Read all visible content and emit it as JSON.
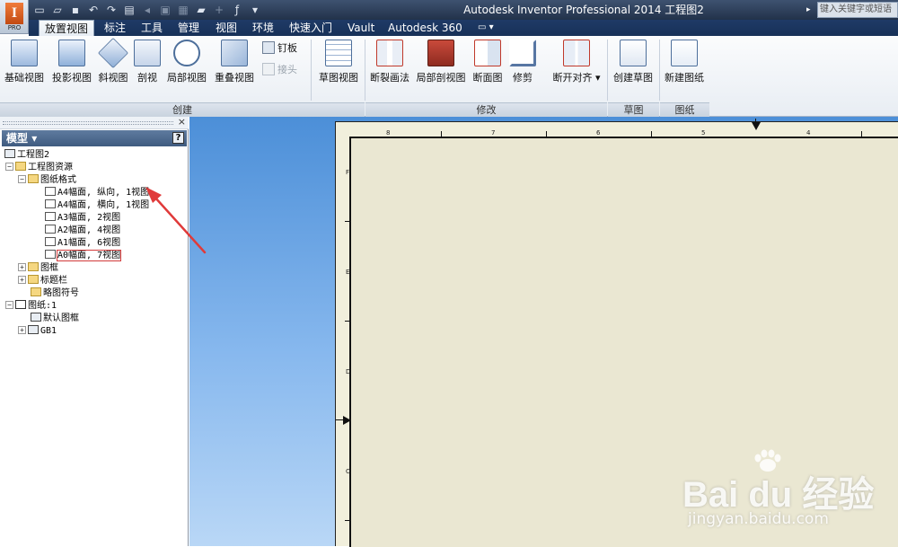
{
  "app": {
    "logo_letter": "I",
    "logo_sub": "PRO"
  },
  "title": "Autodesk Inventor Professional 2014    工程图2",
  "help_search": {
    "placeholder": "键入关键字或短语"
  },
  "qat": [
    "new-icon",
    "open-icon",
    "save-icon",
    "undo-icon",
    "redo-icon",
    "print-icon",
    "home-icon",
    "select-icon",
    "update-icon",
    "return-icon",
    "fx-icon",
    "customize-icon"
  ],
  "tabs": [
    "放置视图",
    "标注",
    "工具",
    "管理",
    "视图",
    "环境",
    "快速入门",
    "Vault",
    "Autodesk 360"
  ],
  "ribbon": {
    "create": {
      "label": "创建",
      "buttons": [
        "基础视图",
        "投影视图",
        "斜视图",
        "剖视",
        "局部视图",
        "重叠视图"
      ],
      "small": [
        "钉板",
        "接头"
      ]
    },
    "sketch_view": "草图视图",
    "modify": {
      "label": "修改",
      "buttons": [
        "断裂画法",
        "局部剖视图",
        "断面图",
        "修剪",
        "断开对齐"
      ]
    },
    "sketch": {
      "label": "草图",
      "buttons": [
        "创建草图"
      ]
    },
    "sheet": {
      "label": "图纸",
      "buttons": [
        "新建图纸"
      ]
    }
  },
  "browser": {
    "title": "模型",
    "help": "?",
    "close": "×",
    "tree": [
      {
        "label": "工程图2"
      },
      {
        "label": "工程图资源"
      },
      {
        "label": "图纸格式"
      },
      {
        "label": "A4幅面, 纵向, 1视图"
      },
      {
        "label": "A4幅面, 横向, 1视图"
      },
      {
        "label": "A3幅面, 2视图"
      },
      {
        "label": "A2幅面, 4视图"
      },
      {
        "label": "A1幅面, 6视图"
      },
      {
        "label": "A0幅面, 7视图"
      },
      {
        "label": "图框"
      },
      {
        "label": "标题栏"
      },
      {
        "label": "略图符号"
      },
      {
        "label": "图纸:1"
      },
      {
        "label": "默认图框"
      },
      {
        "label": "GB1"
      }
    ]
  },
  "drawing": {
    "col_zones": [
      "8",
      "7",
      "6",
      "5",
      "4"
    ],
    "row_zones": [
      "F",
      "E",
      "D",
      "C"
    ]
  },
  "annotation_color": "#e03a3a",
  "watermark": {
    "main": "Bai du 经验",
    "sub": "jingyan.baidu.com"
  }
}
